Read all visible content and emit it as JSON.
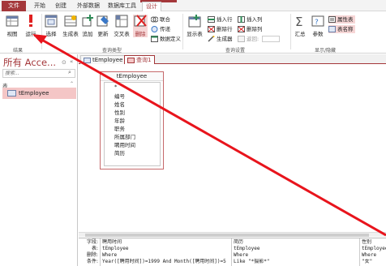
{
  "menubar": {
    "file": "文件",
    "tabs": [
      "开始",
      "创建",
      "外部数据",
      "数据库工具",
      "设计"
    ],
    "active_tab": "设计"
  },
  "ribbon": {
    "results": {
      "view": "视图",
      "run": "运行",
      "group_label": "结果"
    },
    "query_type": {
      "select": "选择",
      "make_table": "生成表",
      "append": "追加",
      "update": "更新",
      "crosstab": "交叉表",
      "delete": "删除",
      "union": "联合",
      "pass_through": "传递",
      "data_definition": "数据定义",
      "group_label": "查询类型"
    },
    "query_setup": {
      "show_table": "显示表",
      "insert_rows": "插入行",
      "delete_rows": "删除行",
      "builder": "生成器",
      "insert_columns": "插入列",
      "delete_columns": "删除列",
      "return": "返回:",
      "group_label": "查询设置"
    },
    "show_hide": {
      "totals": "汇总",
      "parameters": "参数",
      "property_sheet": "属性表",
      "table_names": "表名称",
      "group_label": "显示/隐藏"
    }
  },
  "nav": {
    "title": "所有 Acce...",
    "search_placeholder": "搜索...",
    "section": "表",
    "items": [
      "tEmployee"
    ]
  },
  "doc_tabs": [
    "tEmployee",
    "查询1"
  ],
  "table_box": {
    "title": "tEmployee",
    "fields": [
      "*",
      "编号",
      "姓名",
      "性别",
      "年龄",
      "职务",
      "所属部门",
      "聘用时间",
      "简历"
    ]
  },
  "grid": {
    "row_labels": [
      "字段:",
      "表:",
      "删除:",
      "条件:"
    ],
    "columns": [
      {
        "field": "聘用时间",
        "table": "tEmployee",
        "delete": "Where",
        "criteria": "Year([聘用时间])=1999 And Month([聘用时间])=5"
      },
      {
        "field": "简历",
        "table": "tEmployee",
        "delete": "Where",
        "criteria": "Like \"*摄影*\""
      },
      {
        "field": "性别",
        "table": "tEmployee",
        "delete": "Where",
        "criteria": "\"女\""
      }
    ]
  },
  "colors": {
    "accent": "#a4373a",
    "arrow": "#e8141c",
    "nav_selected": "#f4c6c6"
  }
}
